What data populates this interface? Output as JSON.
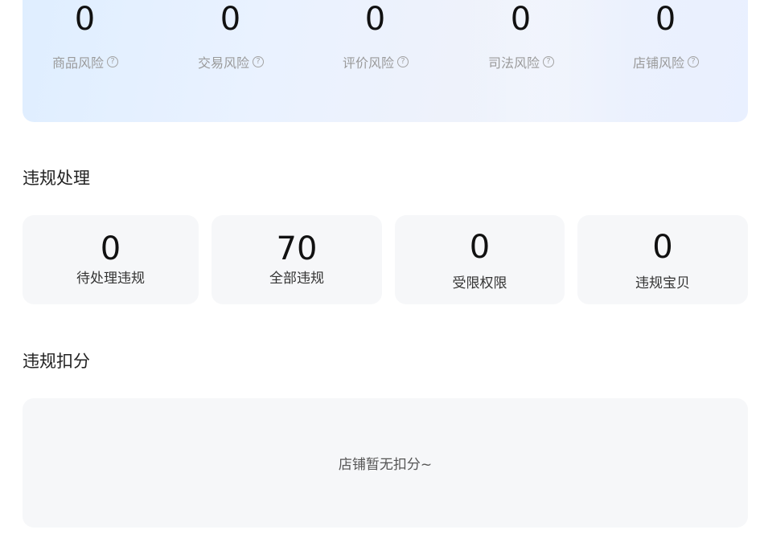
{
  "risk": {
    "items": [
      {
        "value": "0",
        "label": "商品风险"
      },
      {
        "value": "0",
        "label": "交易风险"
      },
      {
        "value": "0",
        "label": "评价风险"
      },
      {
        "value": "0",
        "label": "司法风险"
      },
      {
        "value": "0",
        "label": "店铺风险"
      }
    ],
    "help_glyph": "?"
  },
  "violation": {
    "title": "违规处理",
    "cards": [
      {
        "value": "0",
        "label": "待处理违规"
      },
      {
        "value": "70",
        "label": "全部违规"
      },
      {
        "value": "0",
        "label": "受限权限"
      },
      {
        "value": "0",
        "label": "违规宝贝"
      }
    ]
  },
  "deduction": {
    "title": "违规扣分",
    "empty_text": "店铺暂无扣分~"
  }
}
